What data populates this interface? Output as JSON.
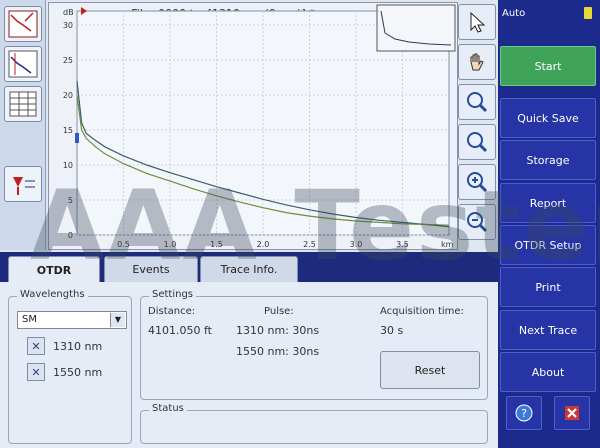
{
  "graph": {
    "title": "Fiber0000.trc [1310 nm (9 µm)] *",
    "y_unit": "dB",
    "x_unit": "km",
    "y_ticks": [
      "0",
      "5",
      "10",
      "15",
      "20",
      "25",
      "30"
    ],
    "x_ticks": [
      "0.5",
      "1.0",
      "1.5",
      "2.0",
      "2.5",
      "3.0",
      "3.5"
    ]
  },
  "chart_data": {
    "type": "line",
    "title": "Fiber0000.trc [1310 nm (9 µm)] *",
    "xlabel": "km",
    "ylabel": "dB",
    "xlim": [
      0,
      4.0
    ],
    "ylim": [
      0,
      32
    ],
    "series": [
      {
        "x": [
          0.0,
          0.05,
          0.1,
          0.2,
          0.3,
          0.5,
          0.75,
          1.0,
          1.25,
          1.5,
          1.75,
          2.0,
          2.25,
          2.5,
          2.75,
          3.0,
          3.25,
          3.5,
          3.75,
          4.0
        ],
        "values": [
          22,
          16,
          14.5,
          13.5,
          12.6,
          11.3,
          10.0,
          8.9,
          7.9,
          6.9,
          6.0,
          5.1,
          4.3,
          3.6,
          3.0,
          2.5,
          2.1,
          1.8,
          1.5,
          1.2
        ]
      },
      {
        "x": [
          0.0,
          0.05,
          0.1,
          0.2,
          0.3,
          0.5,
          0.75,
          1.0,
          1.25,
          1.5,
          1.75,
          2.0,
          2.25,
          2.5,
          2.75,
          3.0,
          3.25,
          3.5,
          3.75,
          4.0
        ],
        "values": [
          20,
          15,
          13.8,
          12.6,
          11.6,
          10.2,
          8.8,
          7.7,
          6.6,
          5.6,
          4.7,
          3.9,
          3.2,
          2.7,
          2.3,
          2.0,
          1.8,
          1.6,
          1.5,
          1.4
        ]
      }
    ]
  },
  "right_menu": {
    "mode": "Auto",
    "items": [
      "Start",
      "Quick Save",
      "Storage",
      "Report",
      "OTDR Setup",
      "Print",
      "Next Trace",
      "About"
    ]
  },
  "tabs": [
    "OTDR",
    "Events",
    "Trace Info."
  ],
  "wavelengths": {
    "title": "Wavelengths",
    "fiber_type": "SM",
    "items": [
      "1310 nm",
      "1550 nm"
    ]
  },
  "settings": {
    "title": "Settings",
    "distance_label": "Distance:",
    "distance_value": "4101.050 ft",
    "pulse_label": "Pulse:",
    "pulse_1310": "1310 nm: 30ns",
    "pulse_1550": "1550 nm: 30ns",
    "acq_label": "Acquisition time:",
    "acq_value": "30 s",
    "reset": "Reset"
  },
  "status": {
    "title": "Status"
  },
  "watermark": "AAA Testers",
  "colors": {
    "accent": "#1c2a8c",
    "start": "#3fa35a",
    "trace1": "#3b5e6e",
    "trace2": "#6f8e3a"
  }
}
